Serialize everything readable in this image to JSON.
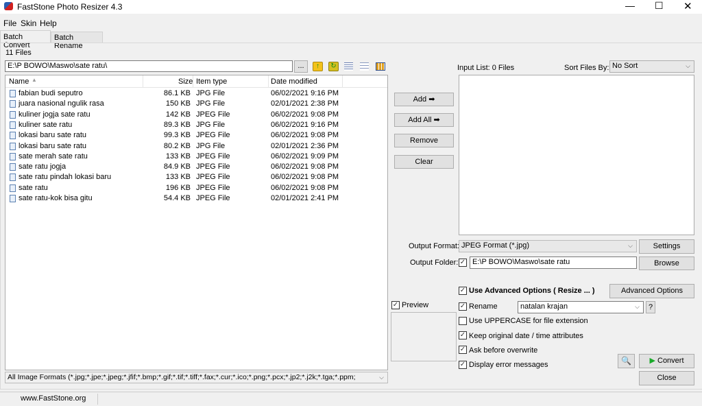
{
  "window": {
    "title": "FastStone Photo Resizer 4.3"
  },
  "menu": [
    "File",
    "Skin",
    "Help"
  ],
  "tabs": [
    "Batch Convert",
    "Batch Rename"
  ],
  "file_count": "11 Files",
  "path": "E:\\P BOWO\\Maswo\\sate ratu\\",
  "browse_dots": "...",
  "columns": {
    "name": "Name",
    "size": "Size",
    "type": "Item type",
    "date": "Date modified"
  },
  "files": [
    {
      "name": "fabian budi seputro",
      "size": "86.1 KB",
      "type": "JPG File",
      "date": "06/02/2021 9:16 PM"
    },
    {
      "name": "juara nasional ngulik rasa",
      "size": "150 KB",
      "type": "JPG File",
      "date": "02/01/2021 2:38 PM"
    },
    {
      "name": "kuliner jogja sate ratu",
      "size": "142 KB",
      "type": "JPEG File",
      "date": "06/02/2021 9:08 PM"
    },
    {
      "name": "kuliner sate ratu",
      "size": "89.3 KB",
      "type": "JPG File",
      "date": "06/02/2021 9:16 PM"
    },
    {
      "name": "lokasi baru sate ratu",
      "size": "99.3 KB",
      "type": "JPEG File",
      "date": "06/02/2021 9:08 PM"
    },
    {
      "name": "lokasi baru sate ratu",
      "size": "80.2 KB",
      "type": "JPG File",
      "date": "02/01/2021 2:36 PM"
    },
    {
      "name": "sate merah sate ratu",
      "size": "133 KB",
      "type": "JPEG File",
      "date": "06/02/2021 9:09 PM"
    },
    {
      "name": "sate ratu jogja",
      "size": "84.9 KB",
      "type": "JPEG File",
      "date": "06/02/2021 9:08 PM"
    },
    {
      "name": "sate ratu pindah lokasi baru",
      "size": "133 KB",
      "type": "JPEG File",
      "date": "06/02/2021 9:08 PM"
    },
    {
      "name": "sate ratu",
      "size": "196 KB",
      "type": "JPEG File",
      "date": "06/02/2021 9:08 PM"
    },
    {
      "name": "sate ratu-kok bisa gitu",
      "size": "54.4 KB",
      "type": "JPEG File",
      "date": "02/01/2021 2:41 PM"
    }
  ],
  "format_filter": "All Image Formats (*.jpg;*.jpe;*.jpeg;*.jfif;*.bmp;*.gif;*.tif;*.tiff;*.fax;*.cur;*.ico;*.png;*.pcx;*.jp2;*.j2k;*.tga;*.ppm;",
  "buttons": {
    "add": "Add ➡",
    "add_all": "Add All ➡",
    "remove": "Remove",
    "clear": "Clear",
    "settings": "Settings",
    "browse": "Browse",
    "advanced": "Advanced Options",
    "help": "?",
    "convert": "Convert",
    "close": "Close"
  },
  "input_list": "Input List:  0 Files",
  "sort_label": "Sort Files By:",
  "sort_value": "No Sort",
  "output_format_label": "Output Format:",
  "output_format": "JPEG Format (*.jpg)",
  "output_folder_label": "Output Folder:",
  "output_folder": "E:\\P BOWO\\Maswo\\sate ratu",
  "options": {
    "advanced": "Use Advanced Options ( Resize ... )",
    "rename": "Rename",
    "rename_value": "natalan krajan",
    "uppercase": "Use UPPERCASE for file extension",
    "keep_date": "Keep original date / time attributes",
    "ask_overwrite": "Ask before overwrite",
    "display_errors": "Display error messages",
    "preview": "Preview"
  },
  "status": "www.FastStone.org"
}
